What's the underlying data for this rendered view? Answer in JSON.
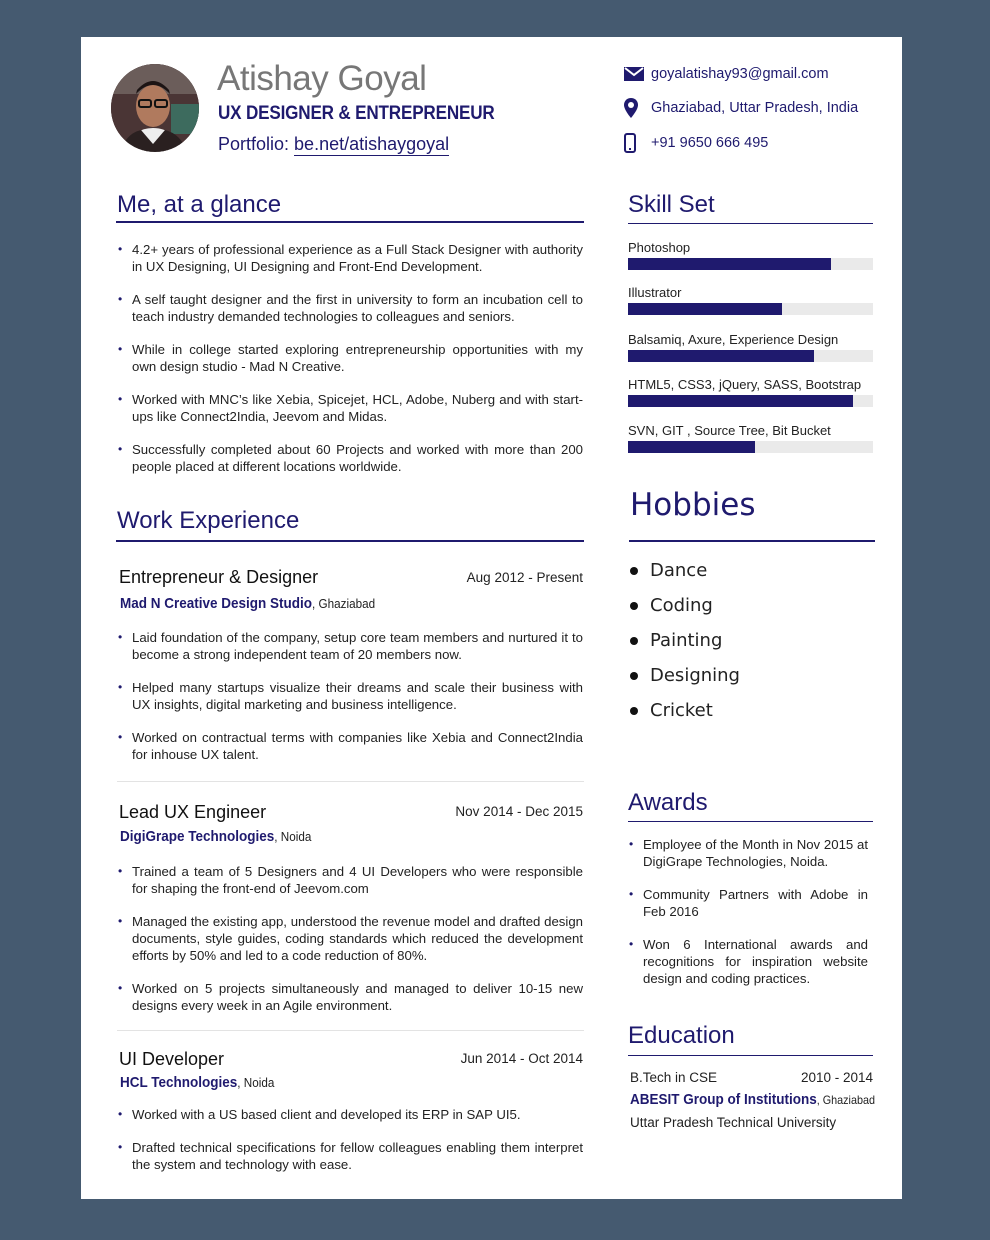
{
  "header": {
    "name": "Atishay Goyal",
    "role": "UX DESIGNER & ENTREPRENEUR",
    "portfolio_label": "Portfolio: ",
    "portfolio_link": "be.net/atishaygoyal",
    "avatar_icon": "profile-photo"
  },
  "contact": {
    "email": "goyalatishay93@gmail.com",
    "location": "Ghaziabad, Uttar Pradesh, India",
    "phone": "+91 9650 666 495",
    "icons": [
      "envelope-icon",
      "map-pin-icon",
      "mobile-phone-icon"
    ]
  },
  "glance": {
    "title": "Me, at a glance",
    "items": [
      "4.2+ years of professional experience as a Full Stack Designer with authority in UX Designing, UI Designing and Front-End Development.",
      "A self taught designer and  the first in university to form an incubation cell to teach industry demanded technologies to colleagues and seniors.",
      "While in college started exploring entrepreneurship opportunities with my own design studio - Mad N Creative.",
      "Worked with MNC’s like Xebia, Spicejet, HCL, Adobe, Nuberg and with start-ups like Connect2India, Jeevom and Midas.",
      "Successfully completed about 60 Projects and worked with more than 200 people placed at different locations worldwide."
    ]
  },
  "work": {
    "title": "Work Experience",
    "jobs": [
      {
        "title": "Entrepreneur & Designer",
        "date": "Aug 2012 - Present",
        "company": "Mad N Creative Design Studio",
        "location": ", Ghaziabad",
        "bullets": [
          "Laid foundation of the company, setup core team members and nurtured it to become a strong independent team of 20 members now.",
          "Helped many startups visualize their dreams and scale their business with UX insights, digital marketing and business intelligence.",
          "Worked on contractual terms with companies like Xebia and Connect2India for inhouse UX talent."
        ]
      },
      {
        "title": "Lead UX Engineer",
        "date": "Nov 2014 - Dec 2015",
        "company": "DigiGrape Technologies",
        "location": ", Noida",
        "bullets": [
          "Trained a team of 5 Designers and 4 UI Developers who were responsible for shaping the front-end of Jeevom.com",
          "Managed the existing app, understood the revenue model and drafted design documents, style guides, coding standards which reduced the development efforts by 50% and led to a code reduction of 80%.",
          "Worked on 5 projects simultaneously and managed to deliver 10-15 new designs every week in an Agile environment."
        ]
      },
      {
        "title": "UI Developer",
        "date": "Jun 2014 - Oct 2014",
        "company": "HCL Technologies",
        "location": ", Noida",
        "bullets": [
          "Worked with a US based client and developed its ERP in SAP UI5.",
          "Drafted technical specifications for fellow colleagues enabling them interpret the system and technology with ease."
        ]
      }
    ]
  },
  "skills": {
    "title": "Skill Set",
    "items": [
      {
        "label": "Photoshop",
        "level": 0.83
      },
      {
        "label": "Illustrator",
        "level": 0.63
      },
      {
        "label": "Balsamiq, Axure, Experience Design",
        "level": 0.76
      },
      {
        "label": "HTML5, CSS3, jQuery, SASS, Bootstrap",
        "level": 0.92
      },
      {
        "label": "SVN, GIT , Source Tree, Bit Bucket",
        "level": 0.52
      }
    ]
  },
  "hobbies": {
    "title": "Hobbies",
    "items": [
      "Dance",
      "Coding",
      "Painting",
      "Designing",
      "Cricket"
    ]
  },
  "awards": {
    "title": "Awards",
    "items": [
      "Employee of the Month in Nov 2015 at DigiGrape Technologies, Noida.",
      "Community Partners with Adobe in Feb 2016",
      "Won 6 International awards and recognitions for inspiration website design and coding practices."
    ]
  },
  "education": {
    "title": "Education",
    "degree": "B.Tech in CSE",
    "years": "2010 - 2014",
    "institution": "ABESIT Group of Institutions",
    "location": ", Ghaziabad",
    "university": "Uttar Pradesh Technical University"
  },
  "colors": {
    "accent": "#1f1a6e",
    "background": "#455a70",
    "track": "#eaeaea"
  }
}
